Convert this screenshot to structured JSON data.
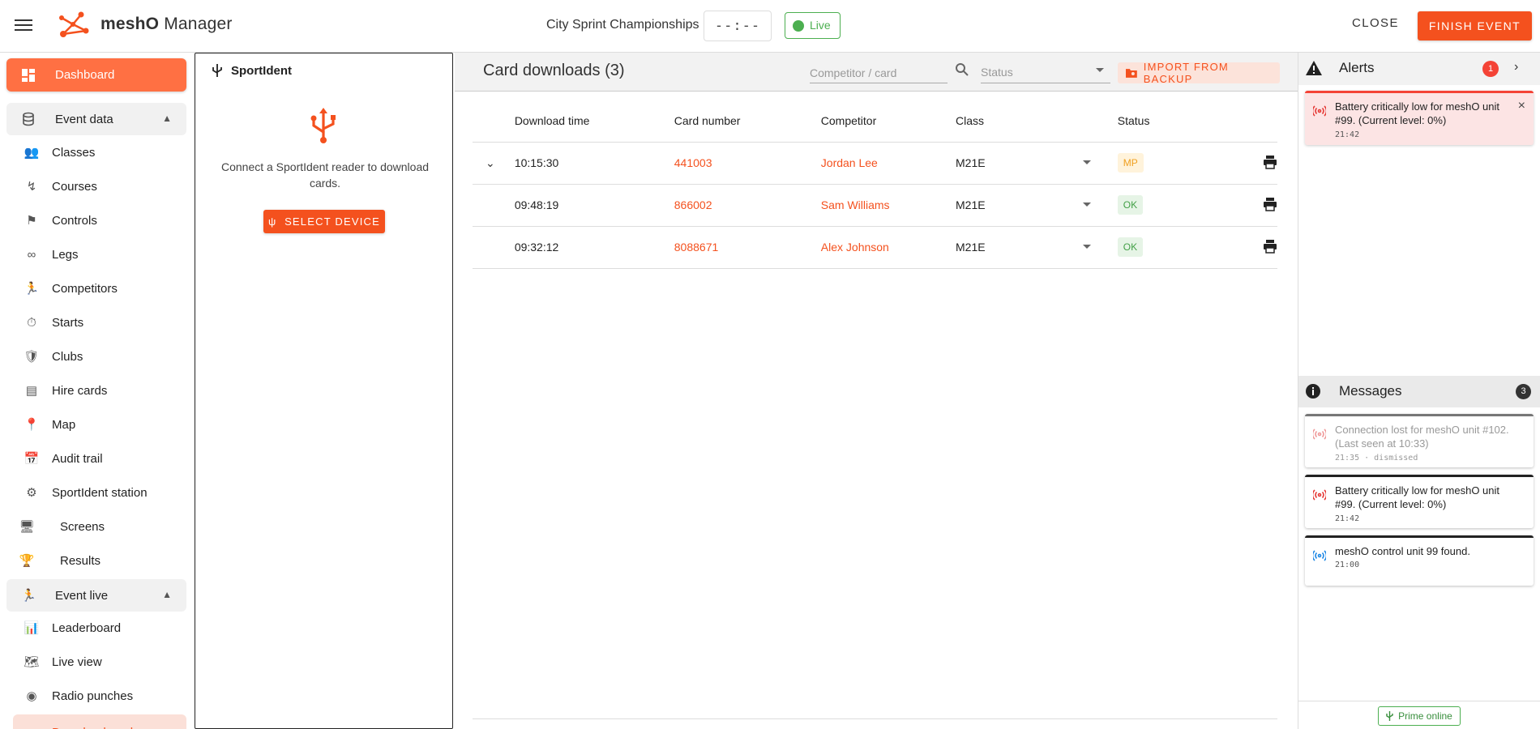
{
  "header": {
    "app_title_bold": "meshO",
    "app_title_rest": " Manager",
    "event_name": "City Sprint Championships",
    "clock": "--:--",
    "live_label": "Live",
    "close_label": "CLOSE",
    "finish_label": "FINISH EVENT"
  },
  "sidebar": {
    "dashboard": "Dashboard",
    "event_data": "Event data",
    "items": [
      {
        "label": "Classes",
        "icon": "people-icon"
      },
      {
        "label": "Courses",
        "icon": "route-icon"
      },
      {
        "label": "Controls",
        "icon": "flag-icon"
      },
      {
        "label": "Legs",
        "icon": "legs-icon"
      },
      {
        "label": "Competitors",
        "icon": "runner-icon"
      },
      {
        "label": "Starts",
        "icon": "stopwatch-icon"
      },
      {
        "label": "Clubs",
        "icon": "shield-icon"
      },
      {
        "label": "Hire cards",
        "icon": "card-icon"
      },
      {
        "label": "Map",
        "icon": "pin-icon"
      },
      {
        "label": "Audit trail",
        "icon": "history-icon"
      },
      {
        "label": "SportIdent station",
        "icon": "chip-icon"
      }
    ],
    "screens": "Screens",
    "results": "Results",
    "event_live": "Event live",
    "live_items": [
      {
        "label": "Leaderboard",
        "icon": "leaderboard-icon"
      },
      {
        "label": "Live view",
        "icon": "live-view-icon"
      },
      {
        "label": "Radio punches",
        "icon": "radio-icon"
      }
    ],
    "download_card": "Download card"
  },
  "sportident": {
    "title": "SportIdent",
    "message": "Connect a SportIdent reader to download cards.",
    "select_label": "SELECT DEVICE"
  },
  "downloads": {
    "title": "Card downloads (3)",
    "search_placeholder": "Competitor / card",
    "status_placeholder": "Status",
    "import_label": "IMPORT FROM BACKUP",
    "columns": [
      "Download time",
      "Card number",
      "Competitor",
      "Class",
      "Status"
    ],
    "rows": [
      {
        "time": "10:15:30",
        "card": "441003",
        "competitor": "Jordan Lee",
        "class": "M21E",
        "status": "MP"
      },
      {
        "time": "09:48:19",
        "card": "866002",
        "competitor": "Sam Williams",
        "class": "M21E",
        "status": "OK"
      },
      {
        "time": "09:32:12",
        "card": "8088671",
        "competitor": "Alex Johnson",
        "class": "M21E",
        "status": "OK"
      }
    ]
  },
  "alerts": {
    "title": "Alerts",
    "count": "1",
    "items": [
      {
        "text": "Battery critically low for meshO unit #99. (Current level: 0%)",
        "time": "21:42"
      }
    ]
  },
  "messages": {
    "title": "Messages",
    "count": "3",
    "items": [
      {
        "text": "Connection lost for meshO unit #102. (Last seen at 10:33)",
        "time": "21:35 · dismissed"
      },
      {
        "text": "Battery critically low for meshO unit #99. (Current level: 0%)",
        "time": "21:42"
      },
      {
        "text": "meshO control unit 99 found.",
        "time": "21:00"
      }
    ]
  },
  "footer": {
    "prime_label": "Prime online"
  },
  "colors": {
    "accent": "#f4511e",
    "accent_light": "#ff7043",
    "live_green": "#4caf50",
    "alert_red": "#f44336"
  }
}
